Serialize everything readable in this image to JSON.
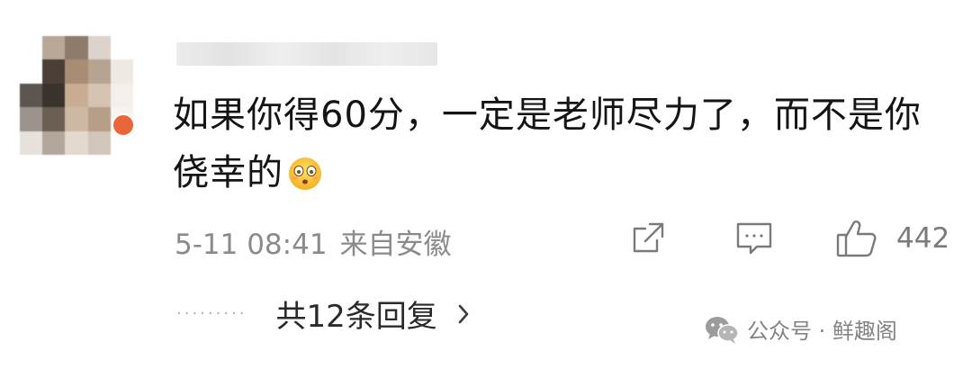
{
  "comment": {
    "text": "如果你得60分，一定是老师尽力了，而不是你侥幸的",
    "emoji": "dizzy-face-emoji",
    "timestamp": "5-11 08:41",
    "location": "来自安徽",
    "like_count": "442",
    "replies_label": "共12条回复",
    "replies_dots": "·········"
  },
  "watermark": {
    "text": "公众号 · 鲜趣阁"
  },
  "colors": {
    "text": "#141414",
    "meta": "#8a8a8a",
    "icon": "#7a7a7a",
    "badge": "#e8663a"
  }
}
